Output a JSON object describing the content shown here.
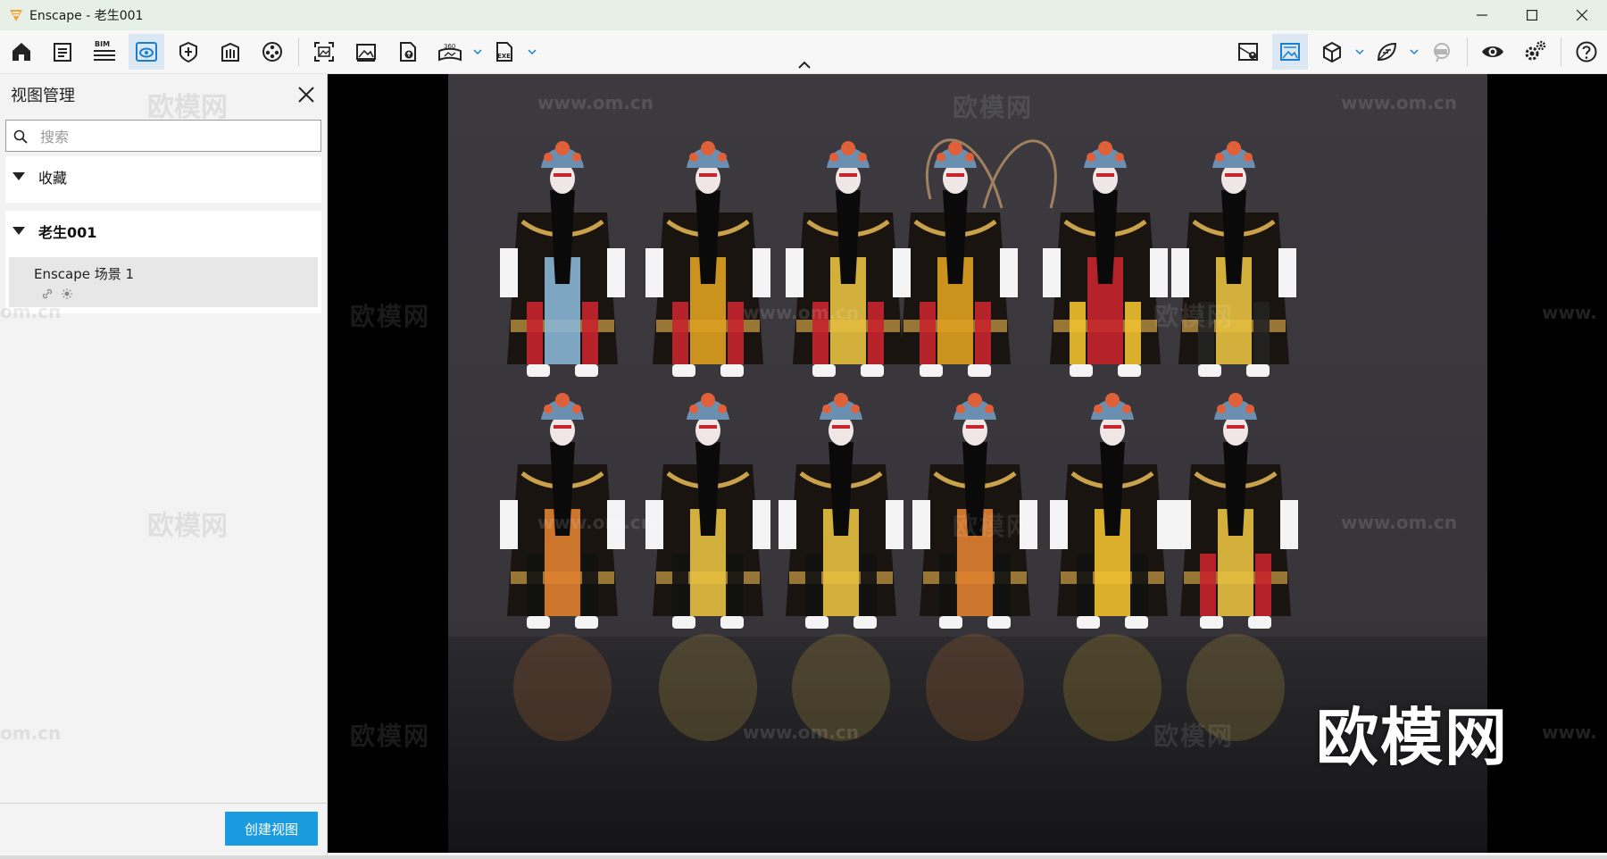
{
  "window": {
    "title": "Enscape - 老生001"
  },
  "toolbar": {
    "bim_label": "BIM",
    "panorama_label": "360",
    "exe_label": "EXE"
  },
  "view_manager": {
    "title": "视图管理",
    "search_placeholder": "搜索",
    "favorites_label": "收藏",
    "group_label": "老生001",
    "views": [
      {
        "label": "Enscape 场景 1"
      }
    ],
    "create_button": "创建视图"
  },
  "viewport": {
    "watermark_brand": "欧模网",
    "watermark_url": "www.om.cn",
    "watermark_url_partial_right": "www.",
    "watermark_url_partial_left": "om.cn"
  },
  "colors": {
    "accent": "#1a9be0",
    "titlebar": "#e6f0e6",
    "active_tool": "#dbe8f3"
  }
}
